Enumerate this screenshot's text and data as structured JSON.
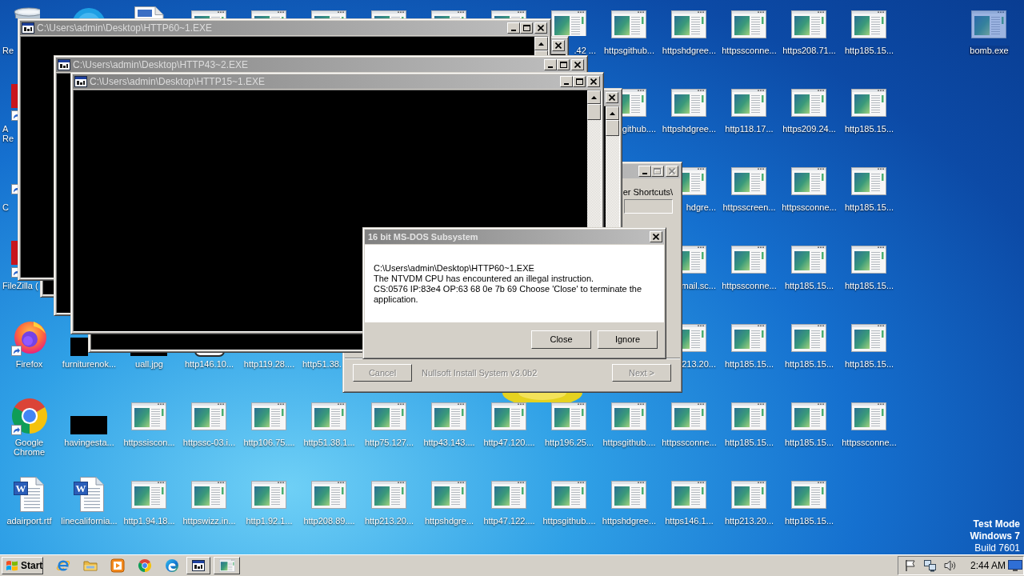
{
  "desktop": {
    "icon_rows": [
      [
        {
          "kind": "recycle-bin",
          "label": [
            "Re"
          ],
          "selected": false
        },
        {
          "kind": "round-app",
          "selected": false
        },
        {
          "kind": "document",
          "selected": false
        },
        {
          "kind": "page",
          "selected": false
        },
        {
          "kind": "page",
          "selected": false
        },
        {
          "kind": "page",
          "selected": false
        },
        {
          "kind": "page",
          "selected": false
        },
        {
          "kind": "page",
          "selected": false
        },
        {
          "kind": "page",
          "selected": false
        },
        {
          "kind": "page",
          "label": [
            ".42 ..."
          ],
          "selected": false
        },
        {
          "kind": "page",
          "label": [
            "httpsgithub..."
          ],
          "selected": false
        },
        {
          "kind": "page",
          "label": [
            "httpshdgree..."
          ],
          "selected": false
        },
        {
          "kind": "page",
          "label": [
            "httpssconne..."
          ],
          "selected": false
        },
        {
          "kind": "page",
          "label": [
            "https208.71..."
          ],
          "selected": false
        },
        {
          "kind": "page",
          "label": [
            "http185.15..."
          ],
          "selected": false
        },
        null,
        {
          "kind": "page",
          "label": [
            "bomb.exe"
          ],
          "selected": true
        }
      ],
      [
        {
          "kind": "shortcut-app",
          "label": [
            "A",
            "Re"
          ],
          "selected": false
        },
        null,
        null,
        null,
        null,
        null,
        null,
        null,
        null,
        null,
        {
          "kind": "page",
          "label": [
            "github...."
          ],
          "selected": false
        },
        {
          "kind": "page",
          "label": [
            "httpshdgree..."
          ],
          "selected": false
        },
        {
          "kind": "page",
          "label": [
            "http118.17..."
          ],
          "selected": false
        },
        {
          "kind": "page",
          "label": [
            "https209.24..."
          ],
          "selected": false
        },
        {
          "kind": "page",
          "label": [
            "http185.15..."
          ],
          "selected": false
        }
      ],
      [
        {
          "kind": "shortcut",
          "label": [
            "C"
          ],
          "selected": false
        },
        null,
        null,
        null,
        null,
        null,
        null,
        null,
        null,
        null,
        null,
        {
          "kind": "page",
          "label": [
            "hdgre..."
          ],
          "selected": false
        },
        {
          "kind": "page",
          "label": [
            "httpsscreen..."
          ],
          "selected": false
        },
        {
          "kind": "page",
          "label": [
            "httpssconne..."
          ],
          "selected": false
        },
        {
          "kind": "page",
          "label": [
            "http185.15..."
          ],
          "selected": false
        }
      ],
      [
        {
          "kind": "shortcut-app",
          "label": [
            "FileZilla ("
          ],
          "selected": false
        },
        null,
        null,
        null,
        null,
        null,
        null,
        null,
        null,
        null,
        null,
        {
          "kind": "page",
          "label": [
            "mail.sc..."
          ],
          "selected": false
        },
        {
          "kind": "page",
          "label": [
            "httpssconne..."
          ],
          "selected": false
        },
        {
          "kind": "page",
          "label": [
            "http185.15..."
          ],
          "selected": false
        },
        {
          "kind": "page",
          "label": [
            "http185.15..."
          ],
          "selected": false
        }
      ],
      [
        {
          "kind": "firefox",
          "label": [
            "Firefox"
          ],
          "selected": false
        },
        {
          "kind": "thumbnail",
          "label": [
            "furniturenok..."
          ],
          "selected": false
        },
        {
          "kind": "thumbnail",
          "label": [
            "uall.jpg"
          ],
          "selected": false
        },
        {
          "kind": "tile",
          "label": [
            "http146.10..."
          ],
          "selected": false
        },
        {
          "label": [
            "http119.28...."
          ],
          "selected": false
        },
        {
          "label": [
            "http51.38."
          ],
          "selected": false
        },
        null,
        null,
        null,
        null,
        null,
        {
          "kind": "page",
          "label": [
            "213.20..."
          ],
          "selected": false
        },
        {
          "kind": "page",
          "label": [
            "http185.15..."
          ],
          "selected": false
        },
        {
          "kind": "page",
          "label": [
            "http185.15..."
          ],
          "selected": false
        },
        {
          "kind": "page",
          "label": [
            "http185.15..."
          ],
          "selected": false
        }
      ],
      [
        {
          "kind": "chrome",
          "label": [
            "Google",
            "Chrome"
          ],
          "selected": false
        },
        {
          "kind": "thumbnail",
          "label": [
            "havingesta..."
          ],
          "selected": false
        },
        {
          "kind": "page",
          "label": [
            "httpssiscon..."
          ],
          "selected": false
        },
        {
          "kind": "page",
          "label": [
            "httpssc-03.i..."
          ],
          "selected": false
        },
        {
          "kind": "page",
          "label": [
            "http106.75...."
          ],
          "selected": false
        },
        {
          "kind": "page",
          "label": [
            "http51.38.1..."
          ],
          "selected": false
        },
        {
          "kind": "page",
          "label": [
            "http75.127..."
          ],
          "selected": false
        },
        {
          "kind": "page",
          "label": [
            "http43.143...."
          ],
          "selected": false
        },
        {
          "kind": "page",
          "label": [
            "http47.120...."
          ],
          "selected": false
        },
        {
          "kind": "page",
          "label": [
            "http196.25..."
          ],
          "selected": false
        },
        {
          "kind": "page",
          "label": [
            "httpsgithub...."
          ],
          "selected": false
        },
        {
          "kind": "page",
          "label": [
            "httpssconne..."
          ],
          "selected": false
        },
        {
          "kind": "page",
          "label": [
            "http185.15..."
          ],
          "selected": false
        },
        {
          "kind": "page",
          "label": [
            "http185.15..."
          ],
          "selected": false
        },
        {
          "kind": "page",
          "label": [
            "httpssconne..."
          ],
          "selected": false
        }
      ],
      [
        {
          "kind": "word",
          "icon_text": "W",
          "label": [
            "adairport.rtf"
          ],
          "selected": false
        },
        {
          "kind": "word",
          "icon_text": "W",
          "label": [
            "linecalifornia..."
          ],
          "selected": false
        },
        {
          "kind": "page",
          "label": [
            "http1.94.18..."
          ],
          "selected": false
        },
        {
          "kind": "page",
          "label": [
            "httpswizz.in..."
          ],
          "selected": false
        },
        {
          "kind": "page",
          "label": [
            "http1.92.1..."
          ],
          "selected": false
        },
        {
          "kind": "page",
          "label": [
            "http208.89...."
          ],
          "selected": false
        },
        {
          "kind": "page",
          "label": [
            "http213.20..."
          ],
          "selected": false
        },
        {
          "kind": "page",
          "label": [
            "httpshdgre..."
          ],
          "selected": false
        },
        {
          "kind": "page",
          "label": [
            "http47.122...."
          ],
          "selected": false
        },
        {
          "kind": "page",
          "label": [
            "httpsgithub...."
          ],
          "selected": false
        },
        {
          "kind": "page",
          "label": [
            "httpshdgree..."
          ],
          "selected": false
        },
        {
          "kind": "page",
          "label": [
            "https146.1..."
          ],
          "selected": false
        },
        {
          "kind": "page",
          "label": [
            "http213.20..."
          ],
          "selected": false
        },
        {
          "kind": "page",
          "label": [
            "http185.15..."
          ],
          "selected": false
        }
      ]
    ],
    "system_notice": [
      {
        "text": "Test Mode",
        "bold": true
      },
      {
        "text": "Windows 7",
        "bold": true
      },
      {
        "text": "Build 7601",
        "bold": false
      }
    ]
  },
  "windows": [
    {
      "kind": "console",
      "controls": [
        {
          "kind": "close",
          "disabled": false
        }
      ]
    },
    {
      "kind": "console",
      "title": "C:\\Users\\admin\\Desktop\\HTTP60~1.EXE",
      "controls": [
        {
          "kind": "minimize",
          "disabled": false
        },
        {
          "kind": "maximize",
          "disabled": false
        },
        {
          "kind": "close",
          "disabled": false
        }
      ],
      "scrollbar": true
    },
    {
      "kind": "console",
      "title": "C:\\Users\\admin\\Desktop\\HTTP43~2.EXE",
      "controls": [
        {
          "kind": "minimize",
          "disabled": false
        },
        {
          "kind": "maximize",
          "disabled": false
        },
        {
          "kind": "close",
          "disabled": false
        }
      ]
    },
    {
      "kind": "installer",
      "controls": [
        {
          "kind": "minimize",
          "disabled": false
        },
        {
          "kind": "maximize",
          "disabled": true
        },
        {
          "kind": "close",
          "disabled": true
        }
      ],
      "path_text": "er Shortcuts\\",
      "branding": "Nullsoft Install System v3.0b2",
      "buttons": [
        {
          "label": "Cancel",
          "disabled": true
        },
        {
          "label": "Next >",
          "disabled": true
        }
      ]
    },
    {
      "kind": "console",
      "controls": [
        {
          "kind": "close",
          "disabled": false
        }
      ],
      "scrollbar": true
    },
    {
      "kind": "console",
      "title": "C:\\Users\\admin\\Desktop\\HTTP15~1.EXE",
      "controls": [
        {
          "kind": "minimize",
          "disabled": false
        },
        {
          "kind": "maximize",
          "disabled": false
        },
        {
          "kind": "close",
          "disabled": false
        }
      ],
      "scrollbar": true
    },
    {
      "kind": "message-box",
      "title": "16 bit MS-DOS Subsystem",
      "controls": [
        {
          "kind": "close",
          "disabled": false
        }
      ],
      "message": [
        "C:\\Users\\admin\\Desktop\\HTTP60~1.EXE",
        "The NTVDM CPU has encountered an illegal instruction.",
        "CS:0576 IP:83e4 OP:63 68 0e 7b 69 Choose 'Close' to terminate the application."
      ],
      "buttons": [
        {
          "label": "Close",
          "disabled": false
        },
        {
          "label": "Ignore",
          "disabled": false
        }
      ]
    }
  ],
  "taskbar": {
    "start": "Start",
    "quick_launch": [
      {
        "kind": "internet-explorer"
      },
      {
        "kind": "folder"
      },
      {
        "kind": "media-player"
      },
      {
        "kind": "chrome"
      },
      {
        "kind": "edge"
      }
    ],
    "tasks": [
      {
        "kind": "console",
        "selected": false
      },
      {
        "kind": "window",
        "selected": false
      }
    ],
    "tray": [
      {
        "kind": "flag"
      },
      {
        "kind": "network"
      },
      {
        "kind": "volume"
      },
      {
        "kind": "clock",
        "text": "2:44 AM"
      },
      {
        "kind": "show-desktop"
      }
    ]
  }
}
